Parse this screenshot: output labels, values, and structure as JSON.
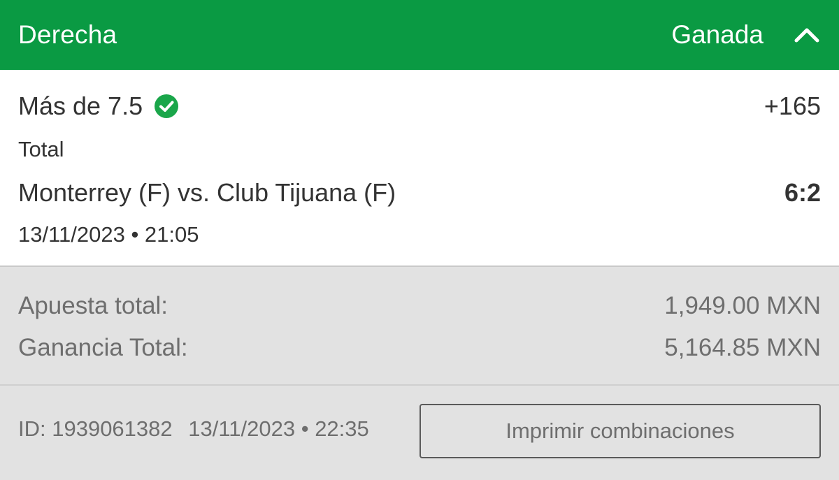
{
  "header": {
    "title": "Derecha",
    "status": "Ganada",
    "bg_color": "#0a9a43",
    "collapse_icon": "chevron-up-icon"
  },
  "selection": {
    "pick": "Más de 7.5",
    "pick_status_icon": "check-circle-icon",
    "odds": "+165",
    "market": "Total",
    "event": "Monterrey (F) vs. Club Tijuana (F)",
    "score": "6:2",
    "event_date": "13/11/2023 • 21:05"
  },
  "totals": {
    "stake_label": "Apuesta total:",
    "stake_value": "1,949.00 MXN",
    "win_label": "Ganancia Total:",
    "win_value": "5,164.85 MXN"
  },
  "footer": {
    "ticket_id": "ID: 1939061382",
    "ticket_date": "13/11/2023 • 22:35",
    "print_button": "Imprimir combinaciones"
  }
}
